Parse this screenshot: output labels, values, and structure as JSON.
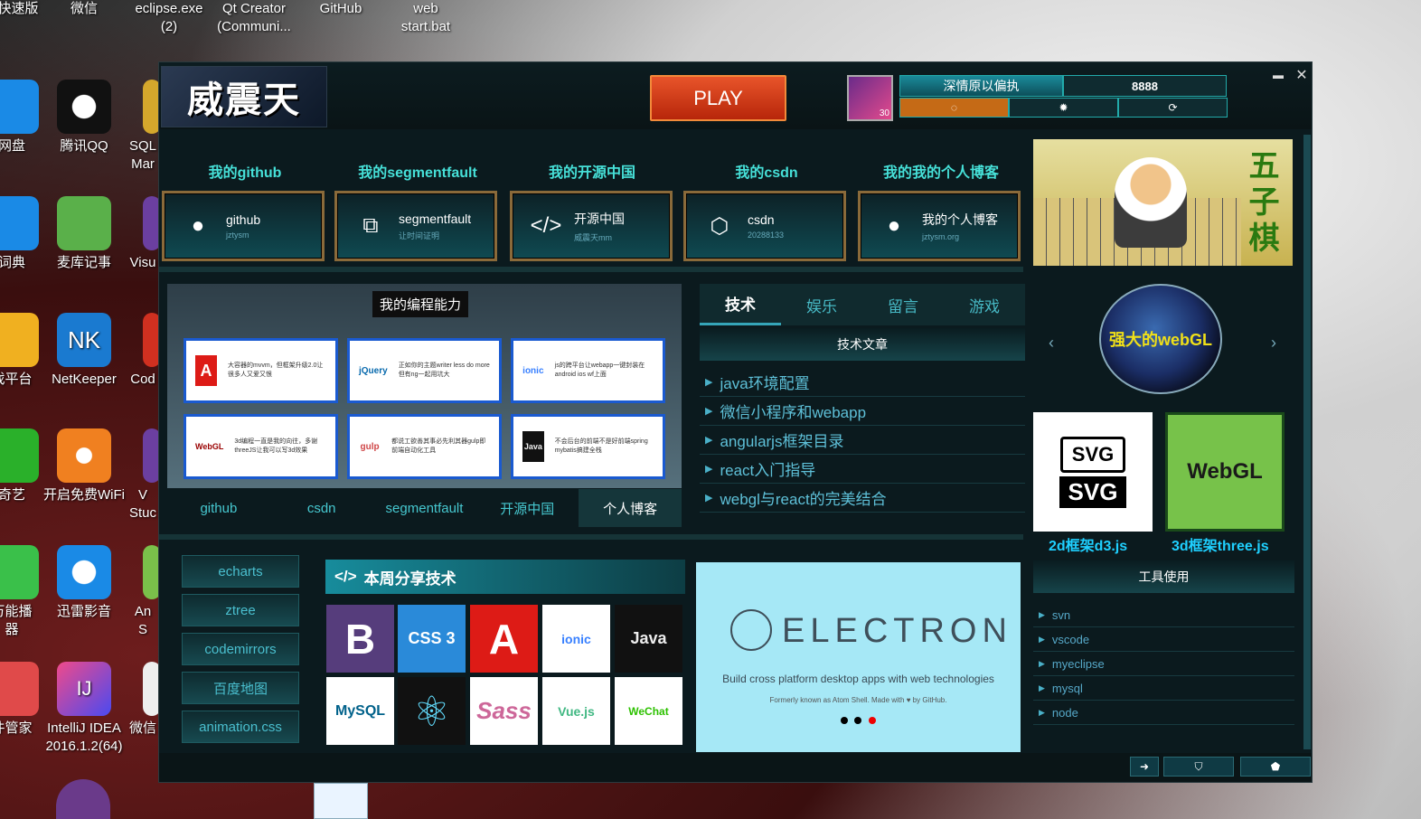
{
  "desktop": {
    "icons_top": [
      "快速版",
      "微信",
      "eclipse.exe\n(2)",
      "Qt Creator\n(Communi...",
      "GitHub",
      "web\nstart.bat"
    ],
    "icons_left": [
      "网盘",
      "腾讯QQ",
      "SQL\nMar",
      "词典",
      "麦库记事",
      "Visu",
      "戏平台",
      "NetKeeper",
      "Cod",
      "奇艺",
      "开启免费WiFi",
      "V\nStuc",
      "万能播\n器",
      "迅雷影音",
      "An\nS",
      "件管家",
      "IntelliJ IDEA\n2016.1.2(64)",
      "微信"
    ]
  },
  "app": {
    "logo": "威震天",
    "play": "PLAY",
    "avatar_level": "30",
    "username": "深情原以偏执",
    "coins": "8888",
    "window_controls": {
      "minimize": "▬",
      "close": "✕"
    }
  },
  "sites": [
    {
      "head": "我的github",
      "title": "github",
      "sub": "jztysm",
      "icon": "github-icon"
    },
    {
      "head": "我的segmentfault",
      "title": "segmentfault",
      "sub": "让时间证明",
      "icon": "segmentfault-icon"
    },
    {
      "head": "我的开源中国",
      "title": "开源中国",
      "sub": "威震天mm",
      "icon": "code-icon"
    },
    {
      "head": "我的csdn",
      "title": "csdn",
      "sub": "20288133",
      "icon": "codepen-icon"
    },
    {
      "head": "我的我的个人博客",
      "title": "我的个人博客",
      "sub": "jztysm.org",
      "icon": "github-icon"
    }
  ],
  "skills": {
    "title": "我的编程能力",
    "cards": [
      {
        "icon": "A",
        "text": "大容器的mvvm，但框架升级2.0让很多人又爱又恨"
      },
      {
        "icon": "jQuery",
        "text": "正如你的主题writer less do more但有ng一起用坑大"
      },
      {
        "icon": "ionic",
        "text": "js的跨平台让webapp一键封装在android ios wf上面"
      },
      {
        "icon": "WebGL",
        "text": "3d编程一直是我的向往，多谢threeJS让我可以写3d效果"
      },
      {
        "icon": "gulp",
        "text": "都说工欲善其事必先利其器gulp即前端自动化工具"
      },
      {
        "icon": "Java",
        "text": "不会后台的前端不是好前端spring mybatis搞建全栈"
      }
    ],
    "links": [
      "github",
      "csdn",
      "segmentfault",
      "开源中国",
      "个人博客"
    ],
    "active": "个人博客"
  },
  "tabs": {
    "items": [
      "技术",
      "娱乐",
      "留言",
      "游戏"
    ],
    "active": "技术",
    "section_title": "技术文章",
    "articles": [
      "java环境配置",
      "微信小程序和webapp",
      "angularjs框架目录",
      "react入门指导",
      "webgl与react的完美结合"
    ]
  },
  "right": {
    "banner_text": "五子棋",
    "globe": "强大的webGL",
    "prev": "‹",
    "next": "›",
    "svg": {
      "top": "SVG",
      "bottom": "SVG",
      "caption": "2d框架d3.js"
    },
    "webgl": {
      "label": "WebGL",
      "caption": "3d框架three.js"
    },
    "tools_title": "工具使用",
    "tools": [
      "svn",
      "vscode",
      "myeclipse",
      "mysql",
      "node"
    ]
  },
  "libs": [
    "echarts",
    "ztree",
    "codemirrors",
    "百度地图",
    "animation.css"
  ],
  "share": {
    "title": "本周分享技术",
    "icon": "</>",
    "tiles": [
      {
        "label": "B",
        "bg": "#563d7c",
        "fg": "#fff"
      },
      {
        "label": "CSS 3",
        "bg": "#2a8ad9",
        "fg": "#fff"
      },
      {
        "label": "A",
        "bg": "#dd1b16",
        "fg": "#fff"
      },
      {
        "label": "ionic",
        "bg": "#fff",
        "fg": "#3880ff"
      },
      {
        "label": "Java",
        "bg": "#111",
        "fg": "#eee"
      },
      {
        "label": "MySQL",
        "bg": "#fff",
        "fg": "#00618a"
      },
      {
        "label": "⚛",
        "bg": "#111",
        "fg": "#61dafb"
      },
      {
        "label": "Sass",
        "bg": "#fff",
        "fg": "#cd6799"
      },
      {
        "label": "Vue.js",
        "bg": "#fff",
        "fg": "#41b883"
      },
      {
        "label": "WeChat",
        "bg": "#fff",
        "fg": "#2dc100"
      }
    ]
  },
  "electron": {
    "title": "ELECTRON",
    "subtitle": "Build cross platform desktop apps with web technologies",
    "note": "Formerly known as Atom Shell. Made with ♥ by GitHub."
  },
  "colors": {
    "accent": "#46e0d8",
    "brand_bg": "#0b1a1e",
    "play": "#d9401a"
  }
}
